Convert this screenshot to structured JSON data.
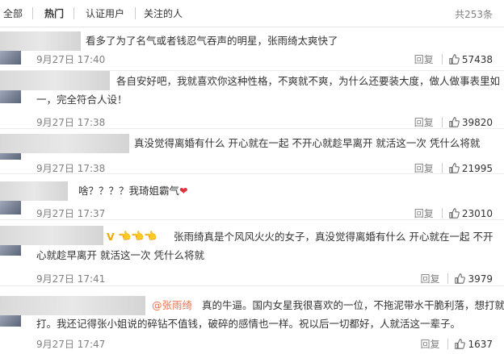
{
  "tabs": [
    {
      "label": "全部"
    },
    {
      "label": "热门"
    },
    {
      "label": "认证用户"
    },
    {
      "label": "关注的人"
    }
  ],
  "total": "共253条",
  "reply_label": "回复",
  "comments": [
    {
      "lines": [
        "看多了为了名气或者钱忍气吞声的明星，张雨绮太爽快了"
      ],
      "time": "9月27日 17:40",
      "likes": "57438"
    },
    {
      "lines": [
        "各自安好吧，我就喜欢你这种性格，不爽就不爽，为什么还要装大度，做人做事表里如",
        "一，完全符合人设！"
      ],
      "time": "9月27日 17:38",
      "likes": "39820"
    },
    {
      "lines": [
        "真没觉得离婚有什么 开心就在一起 不开心就趁早离开 就活这一次 凭什么将就"
      ],
      "time": "9月27日 17:38",
      "likes": "21995"
    },
    {
      "lines": [
        "啥？？？？我琦姐霸气"
      ],
      "heart": "❤",
      "time": "9月27日 17:37",
      "likes": "23010"
    },
    {
      "badge": "V",
      "emoji": "👈👈👈",
      "lines": [
        "张雨绮真是个风风火火的女子，真没觉得离婚有什么 开心就在一起 不开",
        "心就趁早离开 就活这一次 凭什么将就"
      ],
      "time": "9月27日 17:41",
      "likes": "3979"
    },
    {
      "mention": "@张雨绮",
      "lines": [
        "真的牛逼。国内女星我很喜欢的一位，不拖泥带水干脆利落，想打就",
        "打。我还记得张小姐说的碎钻不值钱，破碎的感情也一样。祝以后一切都好，人就活这一辈子。"
      ],
      "time": "9月27日 17:47",
      "likes": "1637"
    }
  ]
}
